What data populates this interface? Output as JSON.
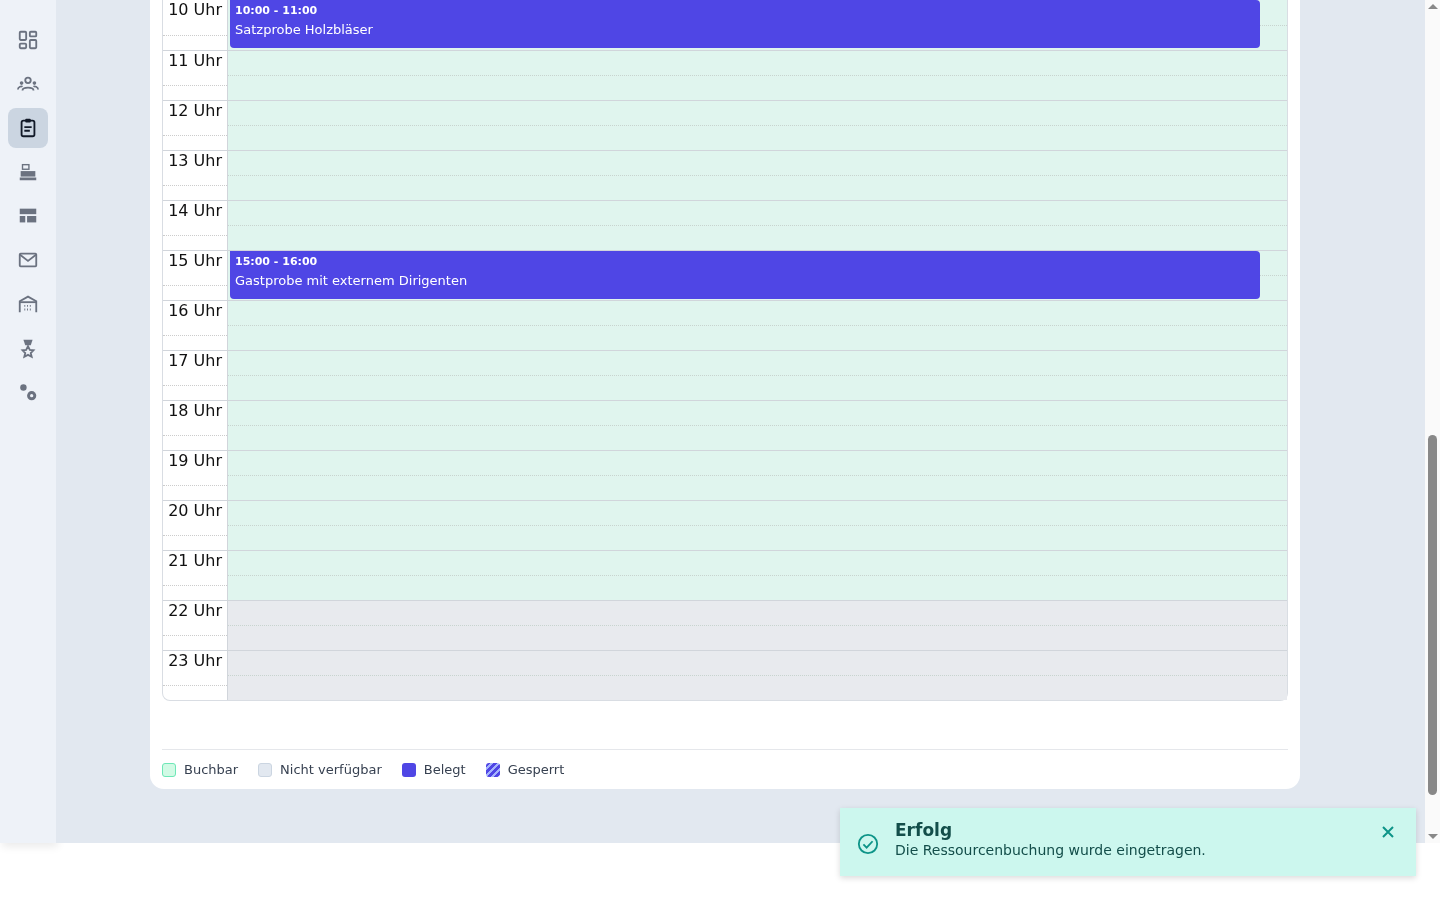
{
  "sidebar": {
    "items": [
      {
        "selected": false
      },
      {
        "selected": false
      },
      {
        "selected": true
      },
      {
        "selected": false
      },
      {
        "selected": false
      },
      {
        "selected": false
      },
      {
        "selected": false
      },
      {
        "selected": false
      },
      {
        "selected": false
      }
    ]
  },
  "calendar": {
    "hours": [
      {
        "label": "10 Uhr",
        "kind": "bookable",
        "event": {
          "time": "10:00 - 11:00",
          "title": "Satzprobe Holzbläser"
        }
      },
      {
        "label": "11 Uhr",
        "kind": "bookable"
      },
      {
        "label": "12 Uhr",
        "kind": "bookable"
      },
      {
        "label": "13 Uhr",
        "kind": "bookable"
      },
      {
        "label": "14 Uhr",
        "kind": "bookable"
      },
      {
        "label": "15 Uhr",
        "kind": "bookable",
        "event": {
          "time": "15:00 - 16:00",
          "title": "Gastprobe mit externem Dirigenten"
        }
      },
      {
        "label": "16 Uhr",
        "kind": "bookable"
      },
      {
        "label": "17 Uhr",
        "kind": "bookable"
      },
      {
        "label": "18 Uhr",
        "kind": "bookable"
      },
      {
        "label": "19 Uhr",
        "kind": "bookable"
      },
      {
        "label": "20 Uhr",
        "kind": "bookable"
      },
      {
        "label": "21 Uhr",
        "kind": "bookable"
      },
      {
        "label": "22 Uhr",
        "kind": "unavailable"
      },
      {
        "label": "23 Uhr",
        "kind": "unavailable"
      }
    ]
  },
  "legend": [
    {
      "label": "Buchbar",
      "kind": "bookable"
    },
    {
      "label": "Nicht verfügbar",
      "kind": "unavailable"
    },
    {
      "label": "Belegt",
      "kind": "booked"
    },
    {
      "label": "Gesperrt",
      "kind": "blocked"
    }
  ],
  "toast": {
    "title": "Erfolg",
    "message": "Die Ressourcenbuchung wurde eingetragen."
  }
}
